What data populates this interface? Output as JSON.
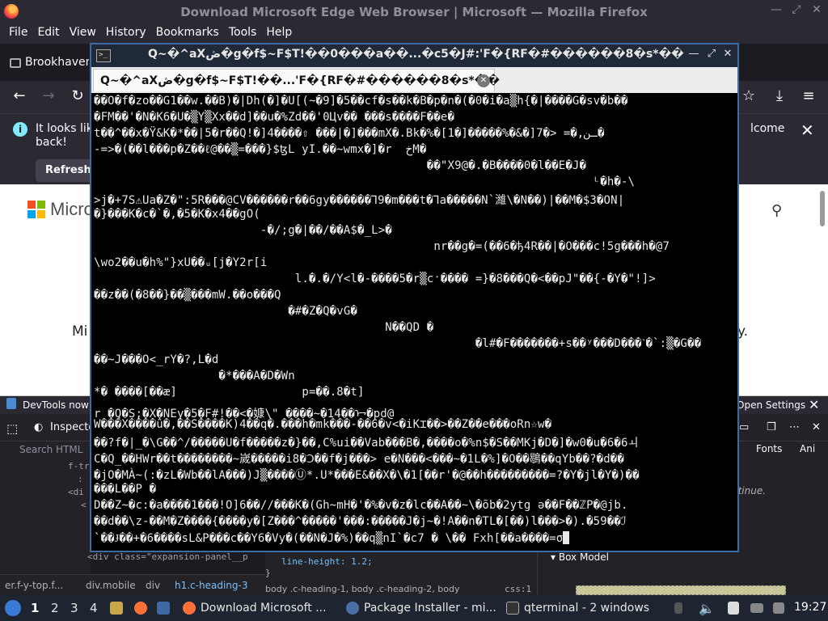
{
  "firefox": {
    "window_title": "Download Microsoft Edge Web Browser | Microsoft — Mozilla Firefox",
    "menu": [
      "File",
      "Edit",
      "View",
      "History",
      "Bookmarks",
      "Tools",
      "Help"
    ],
    "tab_label": "Brookhaven",
    "infobar": {
      "text_left": "It looks lik back!",
      "text_right": "lcome",
      "refresh_label": "Refresh"
    },
    "page": {
      "brand_partial": "Micro",
      "side_text_left": "Mi",
      "side_text_right": "y."
    }
  },
  "devtools": {
    "notice_left": "DevTools now f",
    "notice_right": "Open Settings",
    "inspector_label": "Inspecto",
    "search_placeholder": "Search HTML",
    "fonts_tab": "Fonts",
    "animations_tab": "Ani",
    "continue_hint": "ntinue.",
    "box_model_label": "Box Model",
    "html_lines": [
      "f-tr",
      ":",
      "<di",
      "<",
      "",
      "",
      "",
      "<div class=\"expansion-panel__p"
    ],
    "breadcrumb": [
      "er.f-y-top.f...",
      "div.mobile",
      "div",
      "h1.c-heading-3"
    ],
    "rule_line": "line-height: 1.2;",
    "rule_close": "}",
    "selector_line": "body .c-heading-1, body .c-heading-2, body",
    "selector_file": "css:1"
  },
  "terminal": {
    "title": "Q~�^aXڞ�g�f$~F$T!��0���a��...�c5�J#:'F�{RF�#������8�s*��",
    "tab_label": "Q~�^aXڞ�g�f$~F$T!��...'F�{RF�#������8�s*��",
    "lines": [
      "��O�f�zo��G1��w.��B)�|Dh(�]�U[(~�9]�5��cf�s��k�B�p�n�(�0�i�a▒h{�|����G�sv�b��",
      "�FM��'�N�K6�U�▒Y▒Xx��d]��u�%Zd��'0Цv�� ���s����F��e�",
      "t��^��x�Ÿ&K�*��|5�r��Q!�]4����⇧ ���|�]���mX�.Bk�%�[ـن,�= <�7[�&�%�����[�1�",
      "-=>�(��l���p�Z��ℓ@��▒=���}$ꜩL yI.��~wmx�]�r  خM�",
      "                                                ��\"X9@�.�B����0�l��E�J�",
      "                                                                        ᴸ�h�-\\",
      ">j�+7S⚠Ua�Z�\":5R���@CV������r��6gy������Ꞁ9�m���t�Ꞁa�����N`濰\\�N��)|��M�$3�ON|",
      "�}���K�c�`�,�5�K�x4��gO(",
      "                        -�/;g�|��/��A$�_L>�",
      "                                                 nr��g�=(��6�ђ4R��|�O���c!5g���h�@7",
      "\\wo2��u�h%\"}xU��ᵤ[j�Y2r[i",
      "                             l.�.�/Y<l�-����5�r▒cˑ���� =}�8���Q�<��pJ\"��{-�Y�\"!]>",
      "��z��(�8��}��▒���mW.��o���Q",
      "                            �#�Z�Q�vG�",
      "                                          N��QD �",
      "                                                       �l#�F�������+s��ʸ���D���ˋ�`:▒�G��",
      "��~J���O<_rY�?,L�d",
      "                  �*���A�D�Wn",
      "*� ����[��æ]                  p=��.8�t]",
      "r �Q�S;�X�NEy�5�F#!��<�嫝\\\" ����~�14��ᢇ�pd@",
      "W���X����û�,��S����K)4��q�.���h�mk���-��6�v<�iK⌶��>��Z��e���oRn☆w�",
      "��?f�|_�\\G��^/�����U�f�����z�}��,C%ui��Vab���B�,����o�%n$�S��MKj�D�]�w0�u�6�6ￏ",
      "C�Q_��HWr��t��������~嵗�����i8�Ↄ��f�j���> e�N���<���~�1L�%]�O��鶡��qYb��?�d��",
      "�jO�MÀ~(:�zL�Wb��lA���)J▒����Ⓤ*.U*���E&��X�\\�1[��r'�@��h���������=?�Y�jl�Y�)��",
      "���L��P �",
      "D��Z~�c:�a����1���!O]6��//���K�(Gh~mH�'�%�v�z�lc��A��~\\�õb�2ytg ǝ��F��ℤP�@jb.",
      "��d��\\z-��M�Z����{����y�[Z���^�����'���:�����J�j~�!A��n�TL�[��)l���>�).�59��ℐ",
      "`��Ɉ��+�6����sL&P���c��Y6�Vy�(��N�J�%)��q▒nI`�c7 � \\�� Fxh[��a����=σ"
    ]
  },
  "taskbar": {
    "workspaces": [
      "1",
      "2",
      "3",
      "4"
    ],
    "apps": [
      "Download Microsoft ...",
      "Package Installer - mi...",
      "qterminal - 2 windows"
    ],
    "clock": "19:27"
  },
  "colors": {
    "terminal_border": "#3d6aa3",
    "firefox_chrome": "#2b2a33",
    "taskbar_bg": "#1e2530"
  }
}
